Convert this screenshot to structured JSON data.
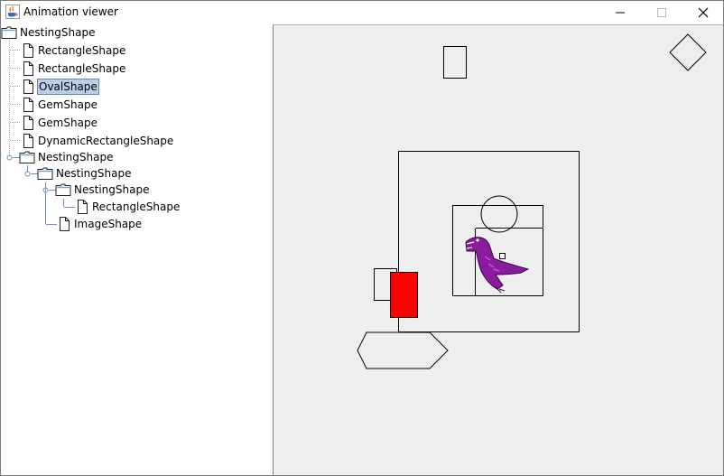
{
  "window": {
    "title": "Animation viewer"
  },
  "tree": [
    {
      "label": "NestingShape",
      "kind": "folder",
      "depth": 0
    },
    {
      "label": "RectangleShape",
      "kind": "leaf",
      "depth": 1
    },
    {
      "label": "RectangleShape",
      "kind": "leaf",
      "depth": 1
    },
    {
      "label": "OvalShape",
      "kind": "leaf",
      "depth": 1,
      "selected": true
    },
    {
      "label": "GemShape",
      "kind": "leaf",
      "depth": 1
    },
    {
      "label": "GemShape",
      "kind": "leaf",
      "depth": 1
    },
    {
      "label": "DynamicRectangleShape",
      "kind": "leaf",
      "depth": 1
    },
    {
      "label": "NestingShape",
      "kind": "folder",
      "depth": 1,
      "expanded": true
    },
    {
      "label": "NestingShape",
      "kind": "folder",
      "depth": 2,
      "expanded": true
    },
    {
      "label": "NestingShape",
      "kind": "folder",
      "depth": 3,
      "expanded": true
    },
    {
      "label": "RectangleShape",
      "kind": "leaf",
      "depth": 4
    },
    {
      "label": "ImageShape",
      "kind": "leaf",
      "depth": 3
    }
  ],
  "colors": {
    "selection_bg": "#b8cfe5",
    "canvas_bg": "#eeeeee",
    "dynamic_fill": "#ff0000",
    "dinosaur": "#8b1a9c"
  },
  "icons": {
    "app": "java-cup-icon",
    "folder": "folder-icon",
    "leaf": "file-icon",
    "handle": "expand-handle-icon"
  }
}
